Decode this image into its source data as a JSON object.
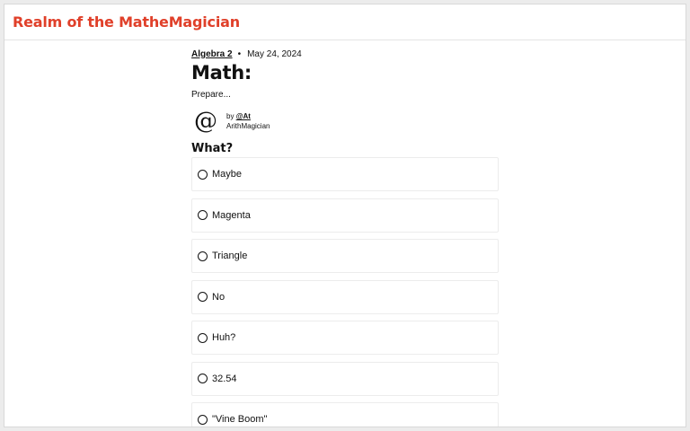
{
  "site": {
    "title": "Realm of the MatheMagician",
    "accent_color": "#e0402a"
  },
  "post": {
    "category": "Algebra 2",
    "separator": "•",
    "date": "May 24, 2024",
    "title": "Math:",
    "subtitle": "Prepare...",
    "author": {
      "avatar_glyph": "@",
      "by_prefix": "by",
      "handle": "@At",
      "name": "ArithMagician"
    }
  },
  "poll": {
    "question": "What?",
    "options": [
      {
        "label": "Maybe"
      },
      {
        "label": "Magenta"
      },
      {
        "label": "Triangle"
      },
      {
        "label": "No"
      },
      {
        "label": "Huh?"
      },
      {
        "label": "32.54"
      },
      {
        "label": "\"Vine Boom\""
      }
    ]
  }
}
